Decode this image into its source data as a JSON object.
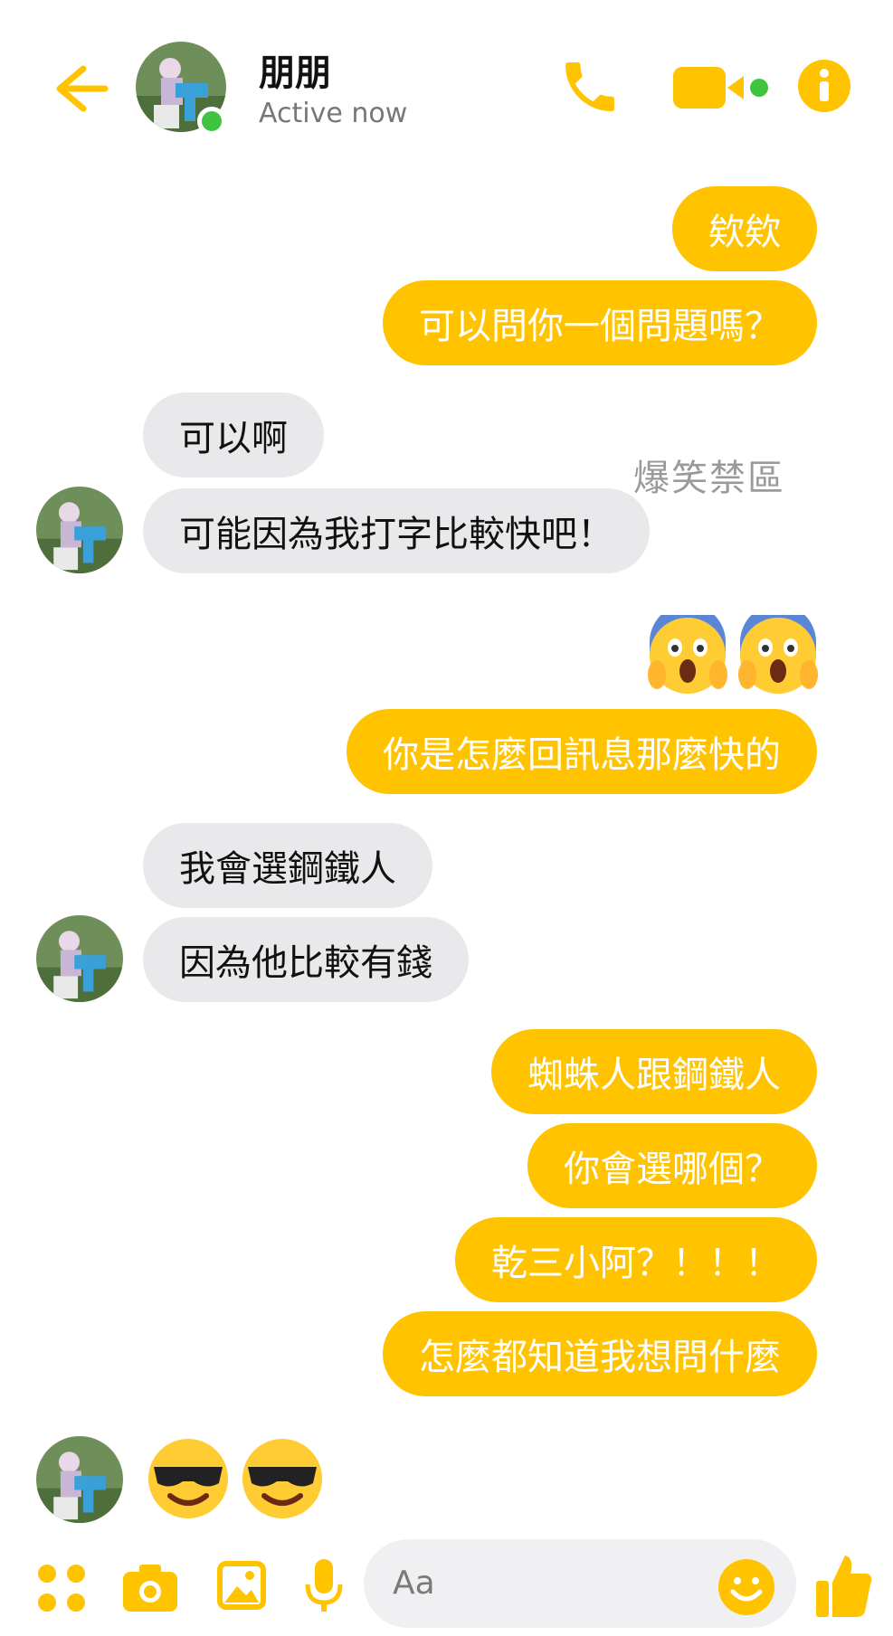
{
  "header": {
    "contact_name": "朋朋",
    "status": "Active now",
    "icons": [
      "back-arrow-icon",
      "phone-icon",
      "video-camera-icon",
      "info-icon"
    ]
  },
  "watermark": "爆笑禁區",
  "messages": [
    {
      "from": "me",
      "text": "欸欸"
    },
    {
      "from": "me",
      "text": "可以問你一個問題嗎？"
    },
    {
      "from": "them",
      "text": "可以啊"
    },
    {
      "from": "them",
      "text": "可能因為我打字比較快吧！"
    },
    {
      "from": "me",
      "emoji": "screaming-face-emoji x2"
    },
    {
      "from": "me",
      "text": "你是怎麼回訊息那麼快的"
    },
    {
      "from": "them",
      "text": "我會選鋼鐵人"
    },
    {
      "from": "them",
      "text": "因為他比較有錢"
    },
    {
      "from": "me",
      "text": "蜘蛛人跟鋼鐵人"
    },
    {
      "from": "me",
      "text": "你會選哪個？"
    },
    {
      "from": "me",
      "text": "乾三小阿？！！！"
    },
    {
      "from": "me",
      "text": "怎麼都知道我想問什麼"
    },
    {
      "from": "them",
      "emoji": "sunglasses-face-emoji x2"
    }
  ],
  "composer": {
    "placeholder": "Aa",
    "icons": [
      "apps-icon",
      "camera-icon",
      "photo-icon",
      "microphone-icon",
      "emoji-icon",
      "thumbs-up-icon"
    ]
  },
  "colors": {
    "accent": "#ffc300",
    "incoming_bubble": "#e9e9eb",
    "online": "#3ec43e"
  }
}
